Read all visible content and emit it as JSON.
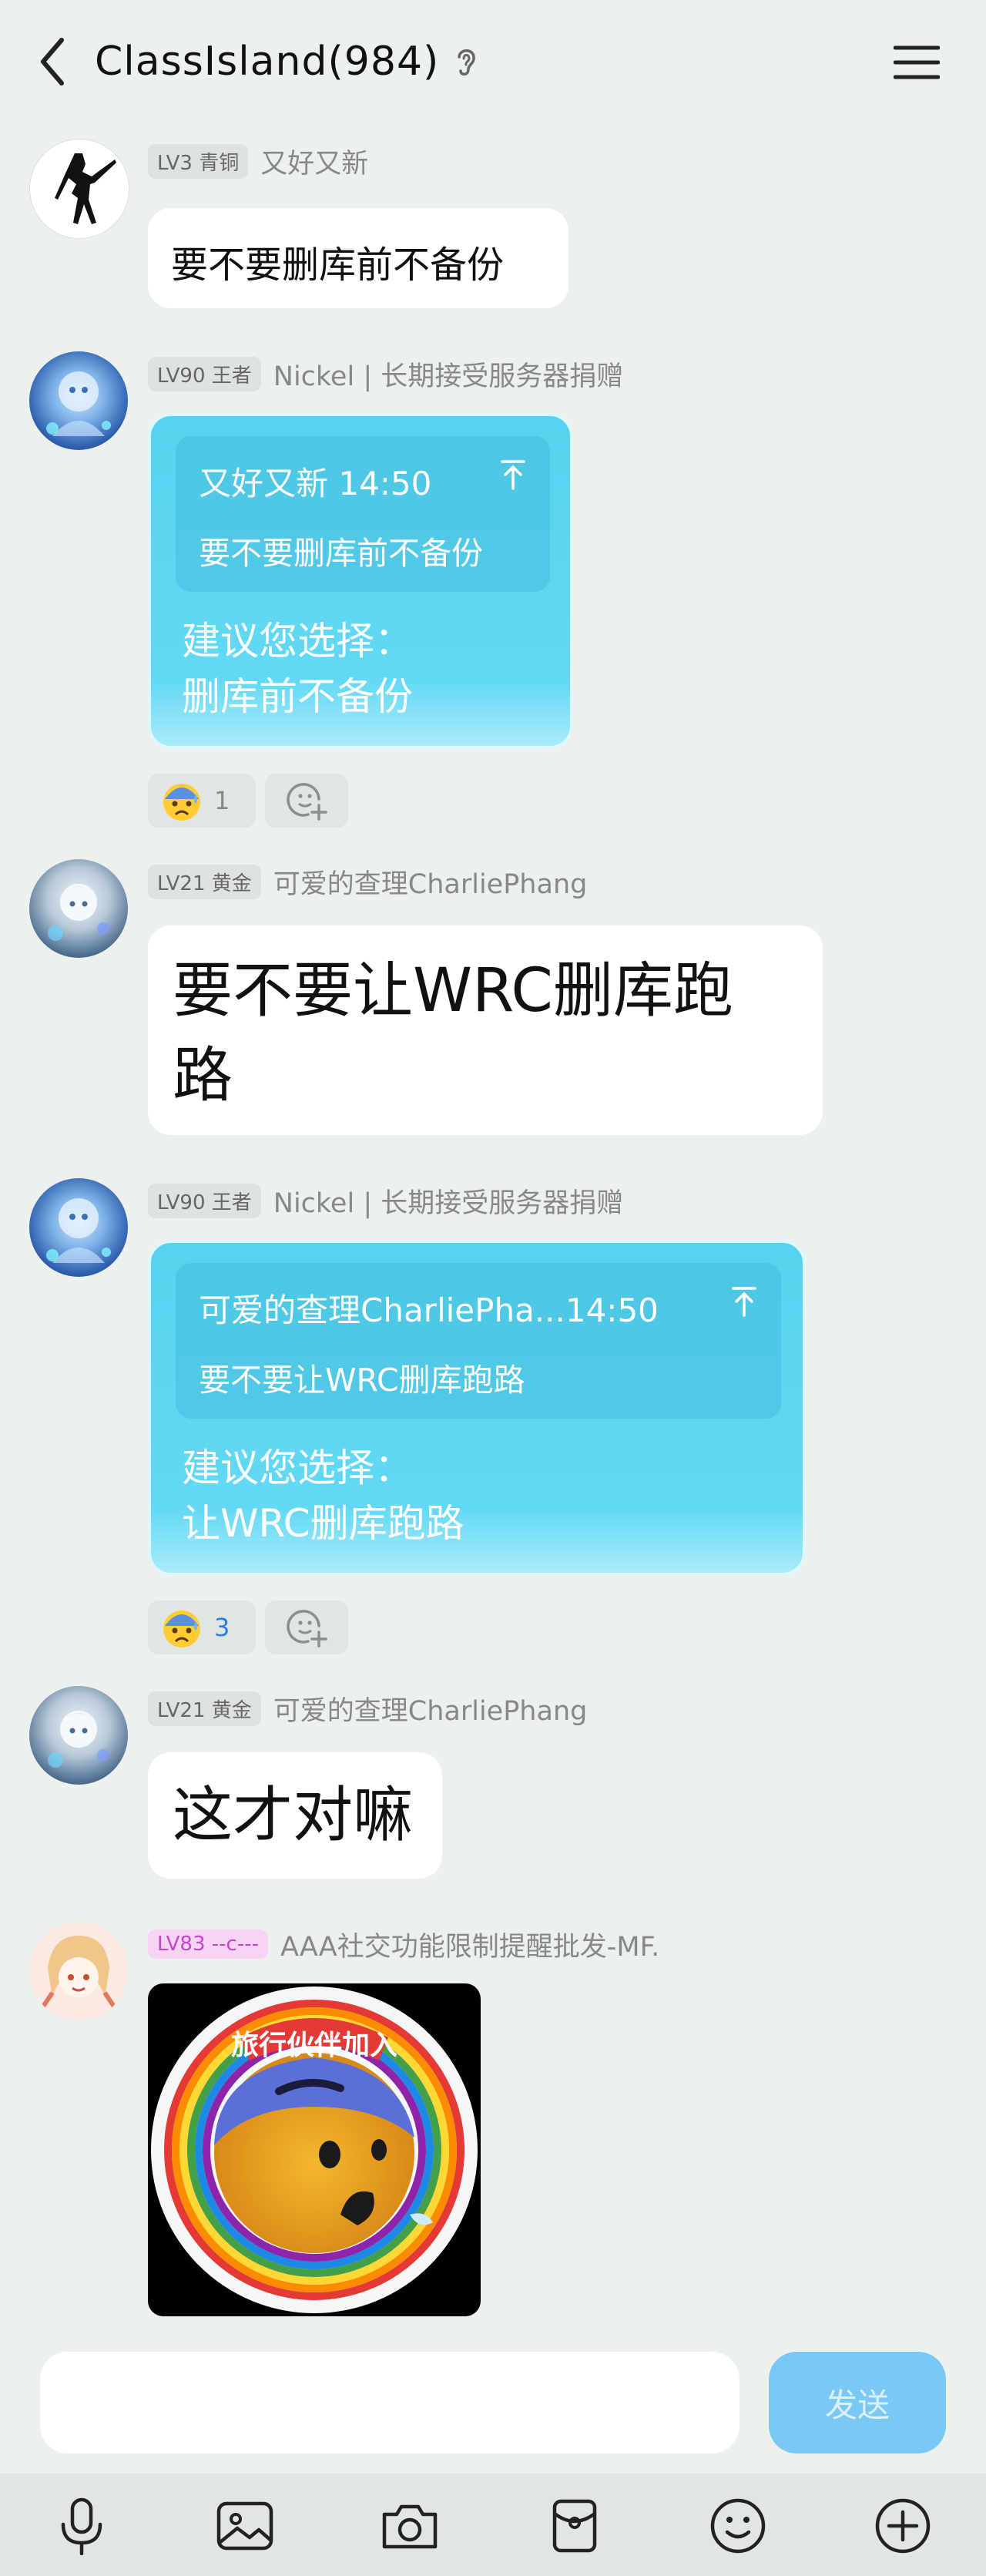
{
  "header": {
    "title": "ClassIsland(984)"
  },
  "messages": [
    {
      "level": "LV3 青铜",
      "nick": "又好又新",
      "text": "要不要删库前不备份"
    },
    {
      "level": "LV90 王者",
      "nick": "Nickel | 长期接受服务器捐赠",
      "quote_head": "又好又新 14:50",
      "quote_body": "要不要删库前不备份",
      "suggest_1": "建议您选择：",
      "suggest_2": "删库前不备份",
      "reaction_count": "1"
    },
    {
      "level": "LV21 黄金",
      "nick": "可爱的查理CharliePhang",
      "text_line1": "要不要让WRC删库跑",
      "text_line2": "路"
    },
    {
      "level": "LV90 王者",
      "nick": "Nickel | 长期接受服务器捐赠",
      "quote_head": "可爱的查理CharliePha...14:50",
      "quote_body": "要不要让WRC删库跑路",
      "suggest_1": "建议您选择：",
      "suggest_2": "让WRC删库跑路",
      "reaction_count": "3"
    },
    {
      "level": "LV21 黄金",
      "nick": "可爱的查理CharliePhang",
      "text": "这才对嘛"
    },
    {
      "level": "LV83 --c---",
      "nick": "AAA社交功能限制提醒批发-MF.",
      "sticker_text": "旅行伙伴加入"
    }
  ],
  "input": {
    "send_label": "发送"
  },
  "colors": {
    "accent": "#58d2ee",
    "send": "#7cc8f4",
    "background": "#edf1ee"
  }
}
